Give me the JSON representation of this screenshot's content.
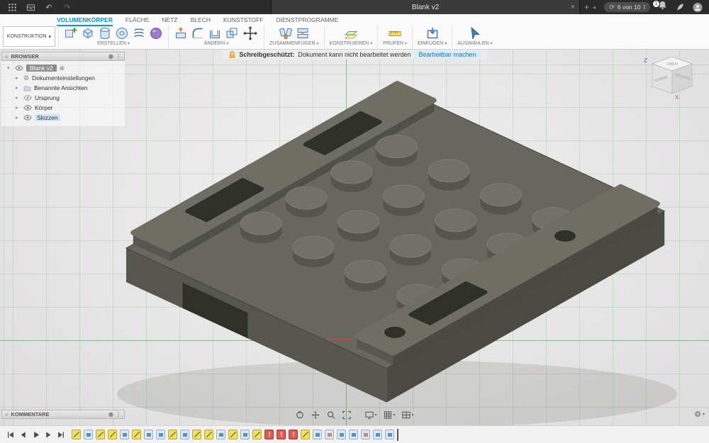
{
  "colors": {
    "accent": "#0696d7",
    "model": {
      "top": "#67675f",
      "side_left": "#57574f",
      "side_right": "#4a4a43",
      "rail_top": "#6e6e65",
      "rail_inner": "#50504a",
      "stud_top": "#71716a",
      "stud_side": "#55554e",
      "stud_edge": "#7d7d74",
      "slot": "#30302b",
      "outline": "#43433d",
      "shadow": "rgba(80,80,75,0.15)"
    }
  },
  "titlebar": {
    "doc_tab": "Blank v2",
    "close_label": "×",
    "job_status": "6 von 10",
    "bell_badge": "1"
  },
  "ribbon": {
    "construction": "KONSTRUKTION",
    "tabs": [
      {
        "label": "VOLUMENKÖRPER"
      },
      {
        "label": "FLÄCHE"
      },
      {
        "label": "NETZ"
      },
      {
        "label": "BLECH"
      },
      {
        "label": "KUNSTSTOFF"
      },
      {
        "label": "DIENSTPROGRAMME"
      }
    ],
    "groups": [
      {
        "label": "ERSTELLEN"
      },
      {
        "label": "ÄNDERN"
      },
      {
        "label": "ZUSAMMENFÜGEN"
      },
      {
        "label": "KONSTRUIEREN"
      },
      {
        "label": "PRÜFEN"
      },
      {
        "label": "EINFÜGEN"
      },
      {
        "label": "AUSWÄHLEN"
      }
    ]
  },
  "warning": {
    "prefix": "Schreibgeschützt:",
    "message": "Dokument kann nicht bearbeitet werden",
    "action": "Bearbeitbar machen"
  },
  "browser": {
    "title": "BROWSER",
    "rows": [
      {
        "label": "Blank v2"
      },
      {
        "label": "Dokumenteinstellungen"
      },
      {
        "label": "Benannte Ansichten"
      },
      {
        "label": "Ursprung"
      },
      {
        "label": "Körper"
      },
      {
        "label": "Skizzen"
      }
    ]
  },
  "comments": {
    "title": "KOMMENTARE"
  },
  "viewcube": {
    "axis_z": "Z",
    "axis_x": "X",
    "top": "OBEN",
    "front": "VORNE",
    "right": "RECHTS"
  },
  "timeline": {
    "items": [
      "sketch",
      "feature",
      "sketch",
      "sketch",
      "feature",
      "sketch",
      "feature",
      "feature",
      "sketch",
      "feature",
      "sketch",
      "sketch",
      "feature",
      "sketch",
      "feature",
      "sketch",
      "error",
      "error",
      "error",
      "sketch",
      "feature",
      "construct",
      "feature",
      "feature",
      "construct",
      "feature",
      "feature"
    ]
  }
}
